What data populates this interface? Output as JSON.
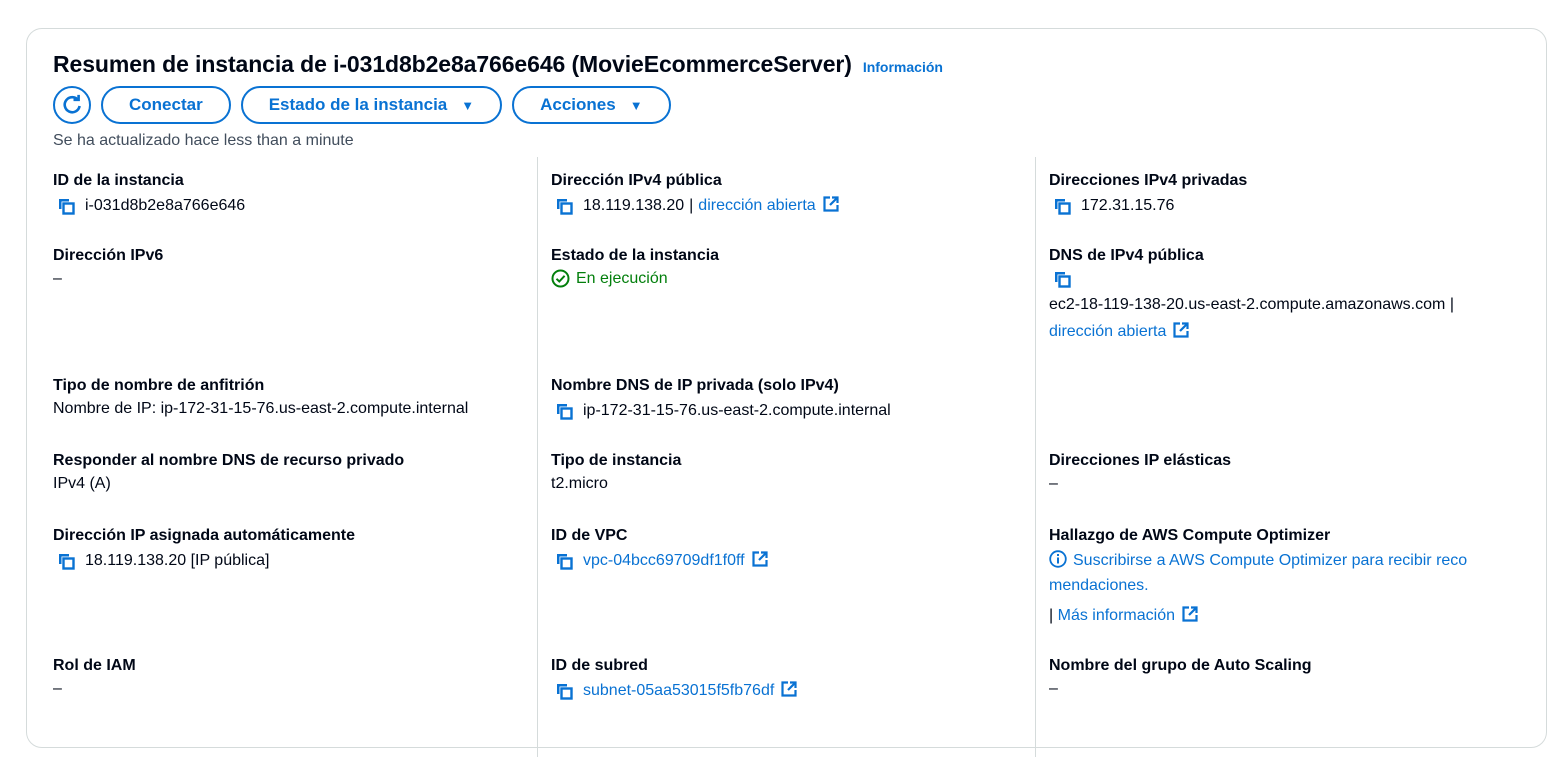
{
  "header": {
    "title": "Resumen de instancia de i-031d8b2e8a766e646 (MovieEcommerceServer)",
    "info_link": "Información"
  },
  "toolbar": {
    "refresh_icon": "refresh-icon",
    "connect_label": "Conectar",
    "instance_state_label": "Estado de la instancia",
    "actions_label": "Acciones",
    "caret": "▼"
  },
  "updated_text": "Se ha actualizado hace less than a minute",
  "colors": {
    "accent": "#0972d3",
    "success": "#037f0c",
    "border": "#d5dbdb"
  },
  "col1": {
    "instance_id": {
      "label": "ID de la instancia",
      "value": "i-031d8b2e8a766e646"
    },
    "ipv6": {
      "label": "Dirección IPv6",
      "value": "–"
    },
    "hostname_type": {
      "label": "Tipo de nombre de anfitrión",
      "value": "Nombre de IP: ip-172-31-15-76.us-east-2.compute.internal"
    },
    "dns_answer": {
      "label": "Responder al nombre DNS de recurso privado",
      "value": "IPv4 (A)"
    },
    "auto_ip": {
      "label": "Dirección IP asignada automáticamente",
      "value": "18.119.138.20 [IP pública]"
    },
    "iam_role": {
      "label": "Rol de IAM",
      "value": "–"
    }
  },
  "col2": {
    "public_ipv4": {
      "label": "Dirección IPv4 pública",
      "value": "18.119.138.20",
      "separator": "|",
      "link": "dirección abierta"
    },
    "instance_state": {
      "label": "Estado de la instancia",
      "value": "En ejecución"
    },
    "private_dns": {
      "label": "Nombre DNS de IP privada (solo IPv4)",
      "value": "ip-172-31-15-76.us-east-2.compute.internal"
    },
    "instance_type": {
      "label": "Tipo de instancia",
      "value": "t2.micro"
    },
    "vpc_id": {
      "label": "ID de VPC",
      "value": "vpc-04bcc69709df1f0ff"
    },
    "subnet_id": {
      "label": "ID de subred",
      "value": "subnet-05aa53015f5fb76df"
    }
  },
  "col3": {
    "private_ipv4": {
      "label": "Direcciones IPv4 privadas",
      "value": "172.31.15.76"
    },
    "public_dns": {
      "label": "DNS de IPv4 pública",
      "value": "ec2-18-119-138-20.us-east-2.compute.amazonaws.com",
      "separator": "|",
      "link": "dirección abierta"
    },
    "elastic_ip": {
      "label": "Direcciones IP elásticas",
      "value": "–"
    },
    "optimizer": {
      "label": "Hallazgo de AWS Compute Optimizer",
      "line1": "Suscribirse a AWS Compute Optimizer para recibir reco",
      "line2": "mendaciones.",
      "separator": "|",
      "more_link": "Más información"
    },
    "asg_name": {
      "label": "Nombre del grupo de Auto Scaling",
      "value": "–"
    }
  }
}
